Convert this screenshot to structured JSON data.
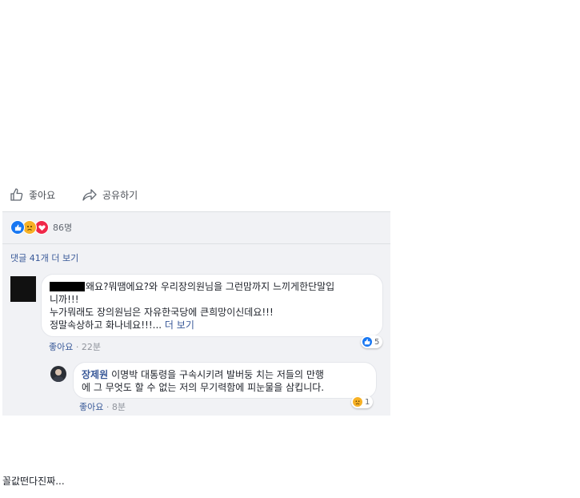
{
  "actions": {
    "like": "좋아요",
    "share": "공유하기"
  },
  "reactions": {
    "count": "86명"
  },
  "more_comments": "댓글 41개 더 보기",
  "comment1": {
    "line1": "왜요?뭐땜에요?와 우리장의원님을 그런맘까지 느끼게한단말입",
    "line2": "니까!!!",
    "line3": "누가뭐래도 장의원님은 자유한국당에 큰희망이신데요!!!",
    "line4": "정말속상하고 화나네요!!!...",
    "see_more": "더 보기",
    "like": "좋아요",
    "dot": "·",
    "time": "22분",
    "reaction_count": "5"
  },
  "reply1": {
    "author": "장제원",
    "line1": "이명박 대통령을 구속시키려 발버둥 치는 저들의 만행",
    "line2": "에 그 무엇도 할 수 없는 저의 무기력함에 피눈물을 삼킵니다.",
    "like": "좋아요",
    "dot": "·",
    "time": "8분",
    "reaction_count": "1"
  },
  "caption": "꼴값떤다진짜..."
}
